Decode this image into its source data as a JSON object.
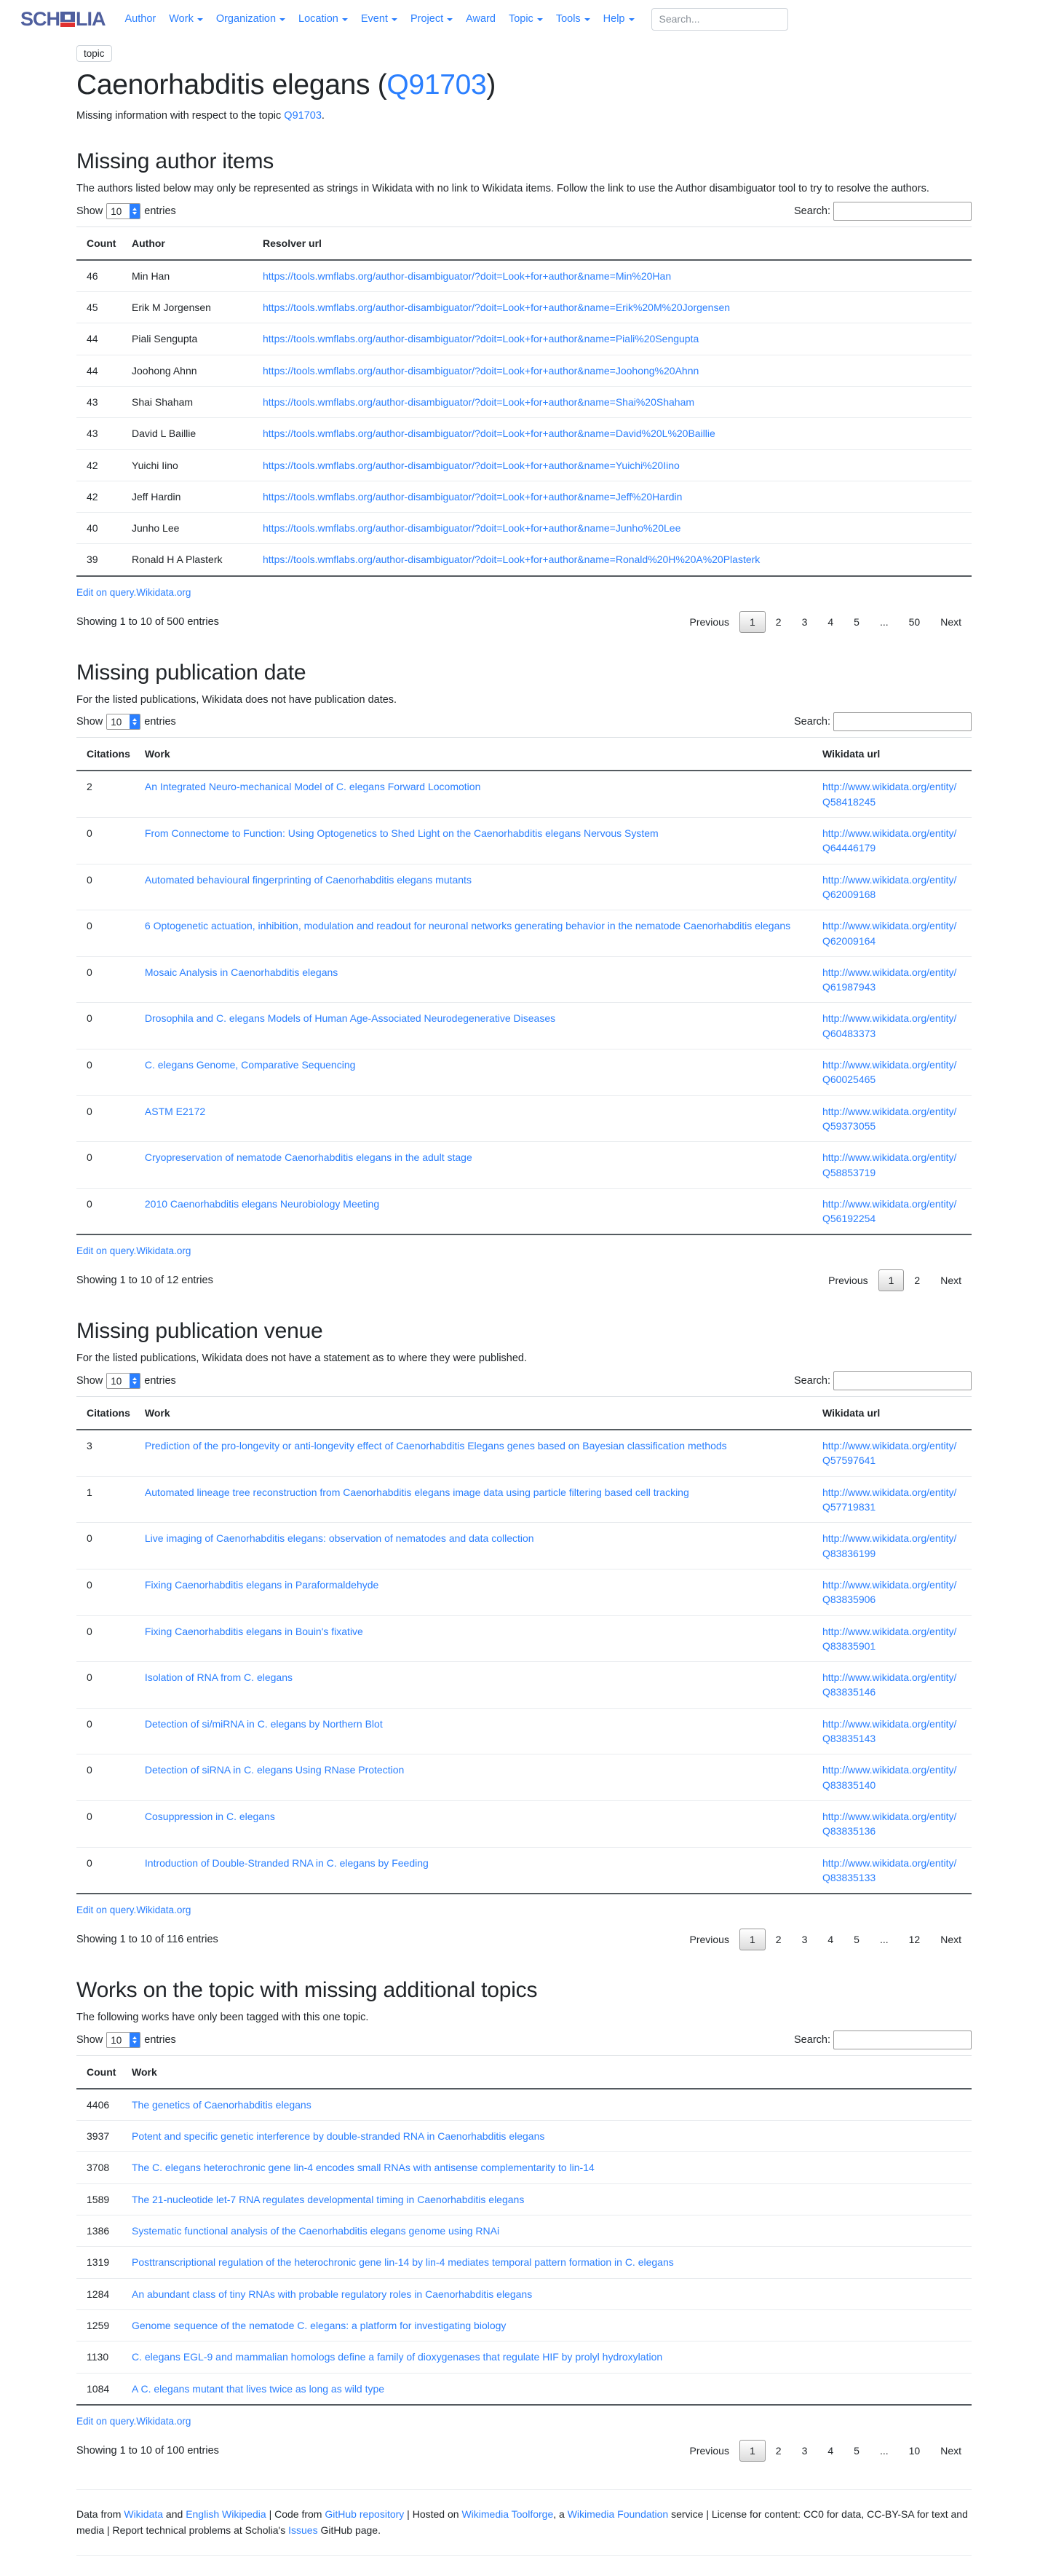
{
  "navbar": {
    "brand": "SCHOLIA",
    "brand_parts": {
      "pre": "SCH",
      "post": "LIA"
    },
    "items": [
      {
        "label": "Author",
        "caret": false
      },
      {
        "label": "Work",
        "caret": true
      },
      {
        "label": "Organization",
        "caret": true
      },
      {
        "label": "Location",
        "caret": true
      },
      {
        "label": "Event",
        "caret": true
      },
      {
        "label": "Project",
        "caret": true
      },
      {
        "label": "Award",
        "caret": false
      },
      {
        "label": "Topic",
        "caret": true
      },
      {
        "label": "Tools",
        "caret": true
      },
      {
        "label": "Help",
        "caret": true
      }
    ],
    "search_placeholder": "Search..."
  },
  "header": {
    "badge": "topic",
    "title": "Caenorhabditis elegans",
    "paren_open": "(",
    "qid": "Q91703",
    "paren_close": ")",
    "subtitle_pre": "Missing information with respect to the topic ",
    "subtitle_link": "Q91703",
    "subtitle_post": "."
  },
  "controls": {
    "show_label": "Show",
    "entries_label": "entries",
    "page_length": "10",
    "search_label": "Search:",
    "search_value": ""
  },
  "pagination_labels": {
    "previous": "Previous",
    "next": "Next",
    "ellipsis": "..."
  },
  "edit_link_label": "Edit on query.Wikidata.org",
  "sections": {
    "missing_author_items": {
      "title": "Missing author items",
      "description": "The authors listed below may only be represented as strings in Wikidata with no link to Wikidata items. Follow the link to use the Author disambiguator tool to try to resolve the authors.",
      "columns": [
        "Count",
        "Author",
        "Resolver url"
      ],
      "rows": [
        {
          "count": "46",
          "author": "Min Han",
          "url": "https://tools.wmflabs.org/author-disambiguator/?doit=Look+for+author&name=Min%20Han"
        },
        {
          "count": "45",
          "author": "Erik M Jorgensen",
          "url": "https://tools.wmflabs.org/author-disambiguator/?doit=Look+for+author&name=Erik%20M%20Jorgensen"
        },
        {
          "count": "44",
          "author": "Piali Sengupta",
          "url": "https://tools.wmflabs.org/author-disambiguator/?doit=Look+for+author&name=Piali%20Sengupta"
        },
        {
          "count": "44",
          "author": "Joohong Ahnn",
          "url": "https://tools.wmflabs.org/author-disambiguator/?doit=Look+for+author&name=Joohong%20Ahnn"
        },
        {
          "count": "43",
          "author": "Shai Shaham",
          "url": "https://tools.wmflabs.org/author-disambiguator/?doit=Look+for+author&name=Shai%20Shaham"
        },
        {
          "count": "43",
          "author": "David L Baillie",
          "url": "https://tools.wmflabs.org/author-disambiguator/?doit=Look+for+author&name=David%20L%20Baillie"
        },
        {
          "count": "42",
          "author": "Yuichi Iino",
          "url": "https://tools.wmflabs.org/author-disambiguator/?doit=Look+for+author&name=Yuichi%20Iino"
        },
        {
          "count": "42",
          "author": "Jeff Hardin",
          "url": "https://tools.wmflabs.org/author-disambiguator/?doit=Look+for+author&name=Jeff%20Hardin"
        },
        {
          "count": "40",
          "author": "Junho Lee",
          "url": "https://tools.wmflabs.org/author-disambiguator/?doit=Look+for+author&name=Junho%20Lee"
        },
        {
          "count": "39",
          "author": "Ronald H A Plasterk",
          "url": "https://tools.wmflabs.org/author-disambiguator/?doit=Look+for+author&name=Ronald%20H%20A%20Plasterk"
        }
      ],
      "info": "Showing 1 to 10 of 500 entries",
      "pages": [
        "1",
        "2",
        "3",
        "4",
        "5",
        "...",
        "50"
      ]
    },
    "missing_publication_date": {
      "title": "Missing publication date",
      "description": "For the listed publications, Wikidata does not have publication dates.",
      "columns": [
        "Citations",
        "Work",
        "Wikidata url"
      ],
      "rows": [
        {
          "citations": "2",
          "work": "An Integrated Neuro-mechanical Model of C. elegans Forward Locomotion",
          "url": "http://www.wikidata.org/entity/Q58418245"
        },
        {
          "citations": "0",
          "work": "From Connectome to Function: Using Optogenetics to Shed Light on the Caenorhabditis elegans Nervous System",
          "url": "http://www.wikidata.org/entity/Q64446179"
        },
        {
          "citations": "0",
          "work": "Automated behavioural fingerprinting of Caenorhabditis elegans mutants",
          "url": "http://www.wikidata.org/entity/Q62009168"
        },
        {
          "citations": "0",
          "work": "6 Optogenetic actuation, inhibition, modulation and readout for neuronal networks generating behavior in the nematode Caenorhabditis elegans",
          "url": "http://www.wikidata.org/entity/Q62009164"
        },
        {
          "citations": "0",
          "work": "Mosaic Analysis in Caenorhabditis elegans",
          "url": "http://www.wikidata.org/entity/Q61987943"
        },
        {
          "citations": "0",
          "work": "Drosophila and C. elegans Models of Human Age-Associated Neurodegenerative Diseases",
          "url": "http://www.wikidata.org/entity/Q60483373"
        },
        {
          "citations": "0",
          "work": "C. elegans Genome, Comparative Sequencing",
          "url": "http://www.wikidata.org/entity/Q60025465"
        },
        {
          "citations": "0",
          "work": "ASTM E2172",
          "url": "http://www.wikidata.org/entity/Q59373055"
        },
        {
          "citations": "0",
          "work": "Cryopreservation of nematode Caenorhabditis elegans in the adult stage",
          "url": "http://www.wikidata.org/entity/Q58853719"
        },
        {
          "citations": "0",
          "work": "2010 Caenorhabditis elegans Neurobiology Meeting",
          "url": "http://www.wikidata.org/entity/Q56192254"
        }
      ],
      "info": "Showing 1 to 10 of 12 entries",
      "pages": [
        "1",
        "2"
      ]
    },
    "missing_publication_venue": {
      "title": "Missing publication venue",
      "description": "For the listed publications, Wikidata does not have a statement as to where they were published.",
      "columns": [
        "Citations",
        "Work",
        "Wikidata url"
      ],
      "rows": [
        {
          "citations": "3",
          "work": "Prediction of the pro-longevity or anti-longevity effect of Caenorhabditis Elegans genes based on Bayesian classification methods",
          "url": "http://www.wikidata.org/entity/Q57597641"
        },
        {
          "citations": "1",
          "work": "Automated lineage tree reconstruction from Caenorhabditis elegans image data using particle filtering based cell tracking",
          "url": "http://www.wikidata.org/entity/Q57719831"
        },
        {
          "citations": "0",
          "work": "Live imaging of Caenorhabditis elegans: observation of nematodes and data collection",
          "url": "http://www.wikidata.org/entity/Q83836199"
        },
        {
          "citations": "0",
          "work": "Fixing Caenorhabditis elegans in Paraformaldehyde",
          "url": "http://www.wikidata.org/entity/Q83835906"
        },
        {
          "citations": "0",
          "work": "Fixing Caenorhabditis elegans in Bouin's fixative",
          "url": "http://www.wikidata.org/entity/Q83835901"
        },
        {
          "citations": "0",
          "work": "Isolation of RNA from C. elegans",
          "url": "http://www.wikidata.org/entity/Q83835146"
        },
        {
          "citations": "0",
          "work": "Detection of si/miRNA in C. elegans by Northern Blot",
          "url": "http://www.wikidata.org/entity/Q83835143"
        },
        {
          "citations": "0",
          "work": "Detection of siRNA in C. elegans Using RNase Protection",
          "url": "http://www.wikidata.org/entity/Q83835140"
        },
        {
          "citations": "0",
          "work": "Cosuppression in C. elegans",
          "url": "http://www.wikidata.org/entity/Q83835136"
        },
        {
          "citations": "0",
          "work": "Introduction of Double-Stranded RNA in C. elegans by Feeding",
          "url": "http://www.wikidata.org/entity/Q83835133"
        }
      ],
      "info": "Showing 1 to 10 of 116 entries",
      "pages": [
        "1",
        "2",
        "3",
        "4",
        "5",
        "...",
        "12"
      ]
    },
    "missing_additional_topics": {
      "title": "Works on the topic with missing additional topics",
      "description": "The following works have only been tagged with this one topic.",
      "columns": [
        "Count",
        "Work"
      ],
      "rows": [
        {
          "count": "4406",
          "work": "The genetics of Caenorhabditis elegans"
        },
        {
          "count": "3937",
          "work": "Potent and specific genetic interference by double-stranded RNA in Caenorhabditis elegans"
        },
        {
          "count": "3708",
          "work": "The C. elegans heterochronic gene lin-4 encodes small RNAs with antisense complementarity to lin-14"
        },
        {
          "count": "1589",
          "work": "The 21-nucleotide let-7 RNA regulates developmental timing in Caenorhabditis elegans"
        },
        {
          "count": "1386",
          "work": "Systematic functional analysis of the Caenorhabditis elegans genome using RNAi"
        },
        {
          "count": "1319",
          "work": "Posttranscriptional regulation of the heterochronic gene lin-14 by lin-4 mediates temporal pattern formation in C. elegans"
        },
        {
          "count": "1284",
          "work": "An abundant class of tiny RNAs with probable regulatory roles in Caenorhabditis elegans"
        },
        {
          "count": "1259",
          "work": "Genome sequence of the nematode C. elegans: a platform for investigating biology"
        },
        {
          "count": "1130",
          "work": "C. elegans EGL-9 and mammalian homologs define a family of dioxygenases that regulate HIF by prolyl hydroxylation"
        },
        {
          "count": "1084",
          "work": "A C. elegans mutant that lives twice as long as wild type"
        }
      ],
      "info": "Showing 1 to 10 of 100 entries",
      "pages": [
        "1",
        "2",
        "3",
        "4",
        "5",
        "...",
        "10"
      ]
    }
  },
  "footer": {
    "t1": "Data from ",
    "l1": "Wikidata",
    "t2": " and ",
    "l2": "English Wikipedia",
    "t3": " | Code from ",
    "l3": "GitHub repository",
    "t4": " | Hosted on ",
    "l4": "Wikimedia Toolforge",
    "t5": ", a ",
    "l5": "Wikimedia Foundation",
    "t6": " service | License for content: CC0 for data, CC-BY-SA for text and media | Report technical problems at Scholia's ",
    "l6": "Issues",
    "t7": " GitHub page."
  },
  "colors": {
    "link": "#2a7fff",
    "brand_blue": "#4f5f9e",
    "brand_red": "#e03030",
    "text": "#212529"
  }
}
